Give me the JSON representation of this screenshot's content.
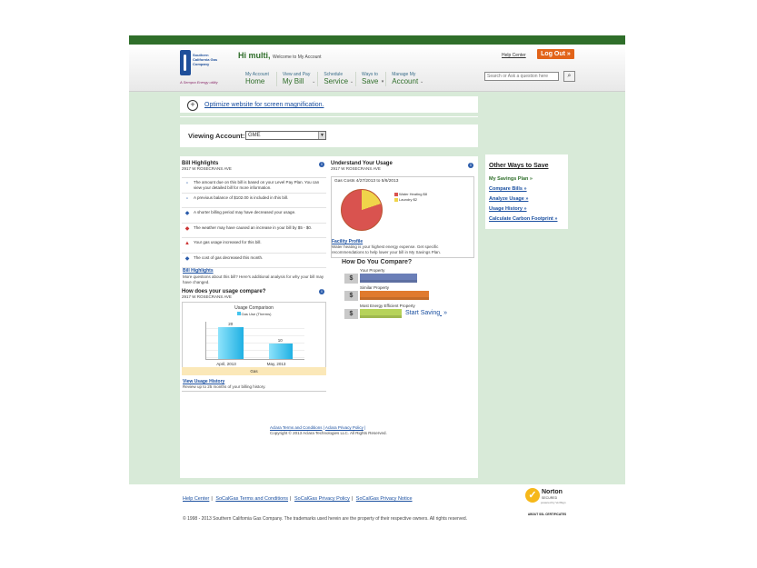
{
  "header": {
    "greeting": "Hi multi,",
    "welcome": "Welcome to My Account",
    "help_center": "Help Center",
    "logout": "Log Out »",
    "search_placeholder": "Search or Ask a question here",
    "logo_text": "Southern California Gas Company",
    "logo_tag": "A Sempra Energy utility",
    "nav": [
      {
        "small": "My Account",
        "big": "Home"
      },
      {
        "small": "View and Pay",
        "big": "My Bill"
      },
      {
        "small": "Schedule",
        "big": "Service"
      },
      {
        "small": "Ways to",
        "big": "Save"
      },
      {
        "small": "Manage My",
        "big": "Account"
      }
    ]
  },
  "magnify": {
    "link": "Optimize website for screen magnification."
  },
  "account": {
    "label": "Viewing Account:",
    "selected": "GME"
  },
  "bill_highlights": {
    "title": "Bill Highlights",
    "address": "2917 W ROSECRANS AVE",
    "rows": [
      "The amount due on this bill is based on your Level Pay Plan. You can view your detailed bill for more information.",
      "A previous balance of $102.00 is included in this bill.",
      "A shorter billing period may have decreased your usage.",
      "The weather may have caused an increase in your bill by $5 - $0.",
      "Your gas usage increased for this bill.",
      "The cost of gas decreased this month."
    ],
    "link": "Bill Highlights",
    "more": "More questions about this bill? Here's additional analysis for why your bill may have changed."
  },
  "usage_compare": {
    "title": "How does your usage compare?",
    "address": "2917 W ROSECRANS AVE",
    "chart_title": "Usage Comparison",
    "legend": "Gas Use (Therms)",
    "band": "Gas",
    "link": "View Usage History",
    "link_sub": "Review up to 25 months of your billing history."
  },
  "chart_data": {
    "type": "bar",
    "title": "Usage Comparison",
    "categories": [
      "April, 2013",
      "May, 2013"
    ],
    "series": [
      {
        "name": "Gas Use (Therms)",
        "values": [
          20,
          10
        ]
      }
    ],
    "ylim": [
      0,
      24
    ]
  },
  "understand_usage": {
    "title": "Understand Your Usage",
    "address": "2917 W ROSECRANS AVE",
    "gas_costs": "Gas Costs 4/27/2013 to 5/6/2013",
    "legend": [
      {
        "label": "Water Heating $8",
        "color": "#d9534f"
      },
      {
        "label": "Laundry $2",
        "color": "#f0d44a"
      }
    ],
    "pie_fraction_water": 0.8,
    "facility_link": "Facility Profile",
    "facility_text": "Water heating is your highest energy expense. Get specific recommendations to help lower your bill in My Savings Plan."
  },
  "compare": {
    "title": "How Do You Compare?",
    "rows": [
      {
        "label": "Your Property",
        "color": "#6b7fb8",
        "fraction": 0.83
      },
      {
        "label": "Similar Property",
        "color": "#e07a2e",
        "fraction": 1.0
      },
      {
        "label": "Most Energy Efficient Property",
        "color": "#b6d35a",
        "fraction": 0.61
      }
    ],
    "dollar": "$",
    "start_saving": "Start Saving",
    "arrow": "»"
  },
  "footer_small": {
    "terms": "Aclara Terms and Conditions",
    "privacy": "Aclara Privacy Policy",
    "sep": "|",
    "copyright": "Copyright © 2013 Aclara Technologies LLC. All Rights Reserved."
  },
  "other_ways": {
    "title": "Other Ways to Save",
    "links": [
      "My Savings Plan »",
      "Compare Bills »",
      "Analyze Usage »",
      "Usage History »",
      "Calculate Carbon Footprint »"
    ]
  },
  "footer": {
    "links": [
      "Help Center",
      "SoCalGas Terms and Conditions",
      "SoCalGas Privacy Policy",
      "SoCalGas Privacy Notice"
    ],
    "sep": "|",
    "copyright": "© 1998 - 2013 Southern California Gas Company. The trademarks used herein are the property of their respective owners. All rights reserved.",
    "norton_title": "Norton",
    "norton_secured": "SECURED",
    "norton_by": "powered by VeriSign",
    "norton_about": "ABOUT SSL CERTIFICATES"
  },
  "colors": {
    "brand_green": "#2f6e2a",
    "page_bg": "#d8ead8",
    "link_blue": "#1a4fa0",
    "logout_orange": "#e2641a"
  },
  "icons": {
    "info": "i",
    "search": "⌕",
    "magnify": "+"
  }
}
